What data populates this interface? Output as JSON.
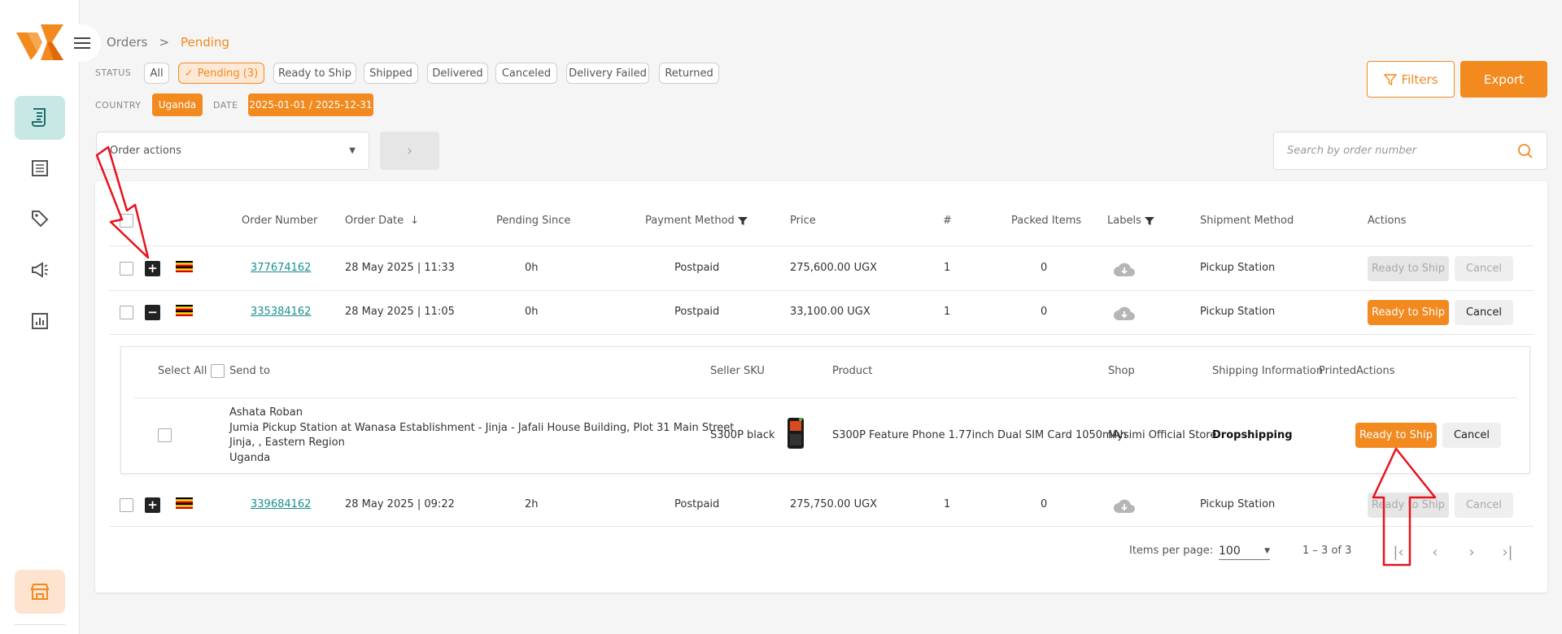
{
  "breadcrumb": {
    "parent": "Orders",
    "separator": ">",
    "current": "Pending"
  },
  "filters": {
    "status_label": "STATUS",
    "status_chips": [
      "All",
      "Pending (3)",
      "Ready to Ship",
      "Shipped",
      "Delivered",
      "Canceled",
      "Delivery Failed",
      "Returned"
    ],
    "country_label": "COUNTRY",
    "country_value": "Uganda",
    "date_label": "DATE",
    "date_value": "2025-01-01 / 2025-12-31"
  },
  "toolbar": {
    "filters_label": "Filters",
    "export_label": "Export",
    "order_actions_placeholder": "Order actions",
    "go_icon": "chevron-right"
  },
  "search": {
    "placeholder": "Search by order number"
  },
  "table": {
    "headers": [
      "Order Number",
      "Order Date",
      "Pending Since",
      "Payment Method",
      "Price",
      "#",
      "Packed Items",
      "Labels",
      "Shipment Method",
      "Actions"
    ],
    "rows": [
      {
        "order_number": "377674162",
        "order_date": "28 May 2025 | 11:33",
        "pending_since": "0h",
        "payment": "Postpaid",
        "price": "275,600.00 UGX",
        "count": "1",
        "packed": "0",
        "shipment": "Pickup Station",
        "rts_label": "Ready to Ship",
        "cancel_label": "Cancel",
        "expanded": false
      },
      {
        "order_number": "335384162",
        "order_date": "28 May 2025 | 11:05",
        "pending_since": "0h",
        "payment": "Postpaid",
        "price": "33,100.00 UGX",
        "count": "1",
        "packed": "0",
        "shipment": "Pickup Station",
        "rts_label": "Ready to Ship",
        "cancel_label": "Cancel",
        "expanded": true
      },
      {
        "order_number": "339684162",
        "order_date": "28 May 2025 | 09:22",
        "pending_since": "2h",
        "payment": "Postpaid",
        "price": "275,750.00 UGX",
        "count": "1",
        "packed": "0",
        "shipment": "Pickup Station",
        "rts_label": "Ready to Ship",
        "cancel_label": "Cancel",
        "expanded": false
      }
    ]
  },
  "sub_table": {
    "headers": {
      "select_all": "Select All",
      "send_to": "Send to",
      "sku": "Seller SKU",
      "product": "Product",
      "shop": "Shop",
      "shipping_info": "Shipping Information",
      "printed": "Printed",
      "actions": "Actions"
    },
    "item": {
      "address_lines": [
        "Ashata Roban",
        "Jumia Pickup Station at Wanasa Establishment - Jinja - Jafali House Building, Plot 31 Main Street",
        "Jinja, , Eastern Region",
        "Uganda"
      ],
      "sku": "S300P black",
      "product": "S300P Feature Phone 1.77inch Dual SIM Card 1050mAh",
      "shop": "Mysimi Official Store",
      "shipping_info": "Dropshipping",
      "rts_label": "Ready to Ship",
      "cancel_label": "Cancel"
    }
  },
  "pagination": {
    "items_per_page_label": "Items per page:",
    "items_per_page": "100",
    "range": "1 – 3 of 3"
  },
  "colors": {
    "accent": "#f28a1f",
    "link": "#1a8f8f",
    "annotation": "#e8121e"
  }
}
